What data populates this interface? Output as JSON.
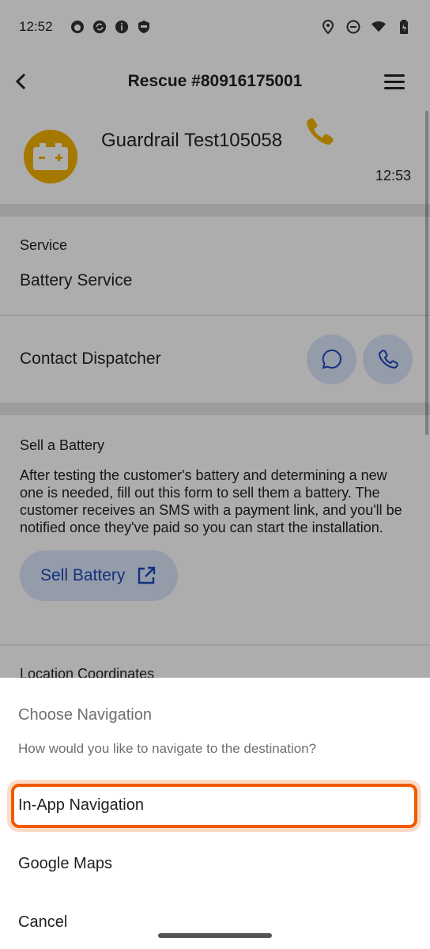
{
  "status_bar": {
    "time": "12:52"
  },
  "header": {
    "title": "Rescue #80916175001"
  },
  "customer": {
    "name": "Guardrail Test105058",
    "time": "12:53",
    "avatar_color": "#f3b300",
    "phone_color": "#f3b300"
  },
  "service": {
    "label": "Service",
    "value": "Battery Service"
  },
  "contact": {
    "label": "Contact Dispatcher"
  },
  "sell": {
    "title": "Sell a Battery",
    "description": "After testing the customer's battery and determining a new one is needed, fill out this form to sell them a battery. The customer receives an SMS with a payment link, and you'll be notified once they've paid so you can start the installation.",
    "button_label": "Sell Battery"
  },
  "location": {
    "label": "Location Coordinates"
  },
  "sheet": {
    "title": "Choose Navigation",
    "subtitle": "How would you like to navigate to the destination?",
    "options": [
      "In-App Navigation",
      "Google Maps",
      "Cancel"
    ]
  },
  "colors": {
    "accent_blue": "#1b47b8",
    "button_bg": "#dbe6fb",
    "highlight": "#f05a00"
  }
}
